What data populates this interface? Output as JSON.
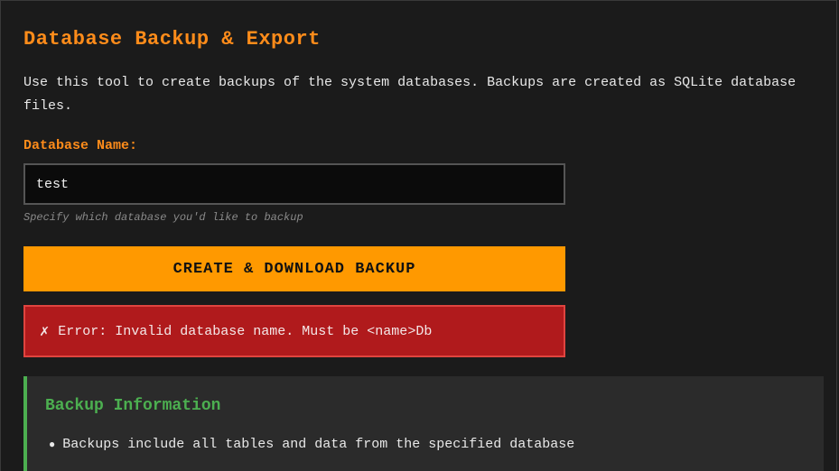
{
  "page": {
    "title": "Database Backup & Export",
    "description": "Use this tool to create backups of the system databases. Backups are created as SQLite database files."
  },
  "form": {
    "label": "Database Name:",
    "input_value": "test",
    "help_text": "Specify which database you'd like to backup",
    "button_label": "CREATE & DOWNLOAD BACKUP"
  },
  "error": {
    "icon": "✗",
    "message": "Error: Invalid database name. Must be <name>Db"
  },
  "info": {
    "title": "Backup Information",
    "items": [
      "Backups include all tables and data from the specified database"
    ]
  },
  "colors": {
    "accent": "#ff8c1a",
    "button": "#ff9900",
    "error": "#b01a1c",
    "info_accent": "#4caf50"
  }
}
